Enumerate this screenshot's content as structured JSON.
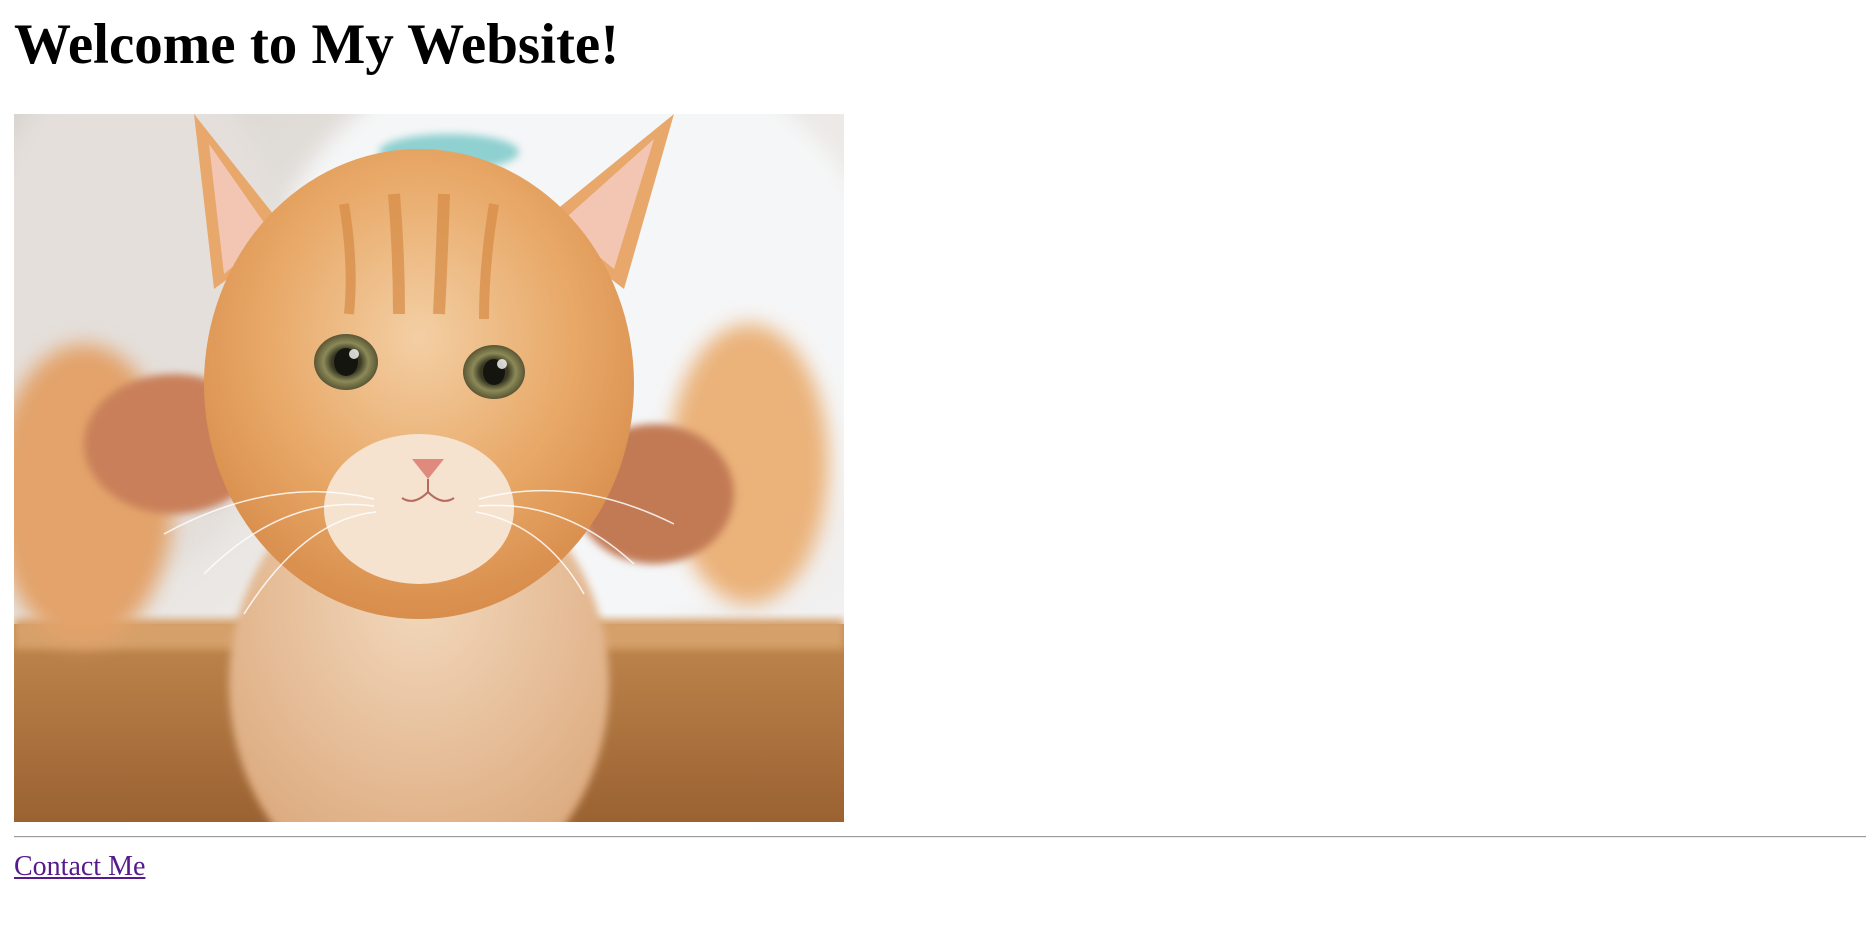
{
  "page": {
    "heading": "Welcome to My Website!",
    "contact_link_label": "Contact Me",
    "image_subject": "orange-tabby-kitten-photo"
  },
  "colors": {
    "background": "#ffffff",
    "heading_text": "#000000",
    "visited_link": "#551a8b",
    "divider": "#9a9a9a"
  }
}
